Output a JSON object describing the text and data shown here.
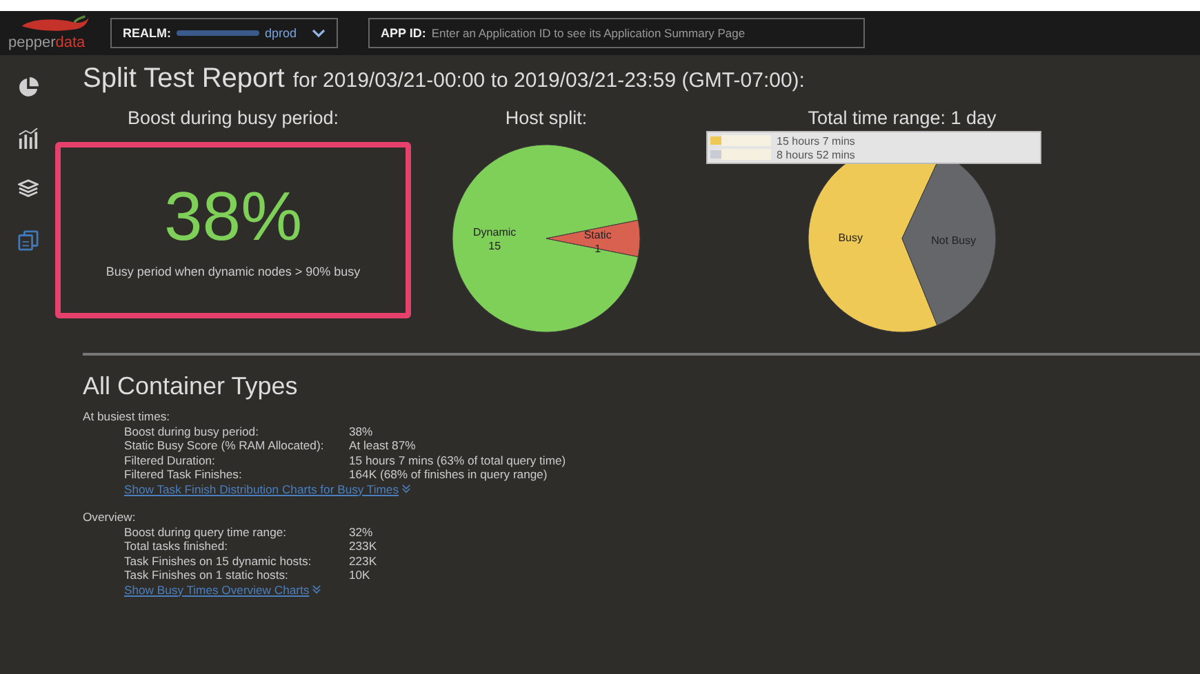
{
  "header": {
    "logo": {
      "first": "pepper",
      "second": "data"
    },
    "realm": {
      "label": "REALM:",
      "value": "dprod"
    },
    "app_id": {
      "label": "APP ID:",
      "placeholder": "Enter an Application ID to see its Application Summary Page"
    }
  },
  "sidebar": {
    "items": [
      {
        "kind": "pie",
        "selected": false
      },
      {
        "kind": "bars",
        "selected": false
      },
      {
        "kind": "layers",
        "selected": false
      },
      {
        "kind": "documents",
        "selected": true
      }
    ]
  },
  "report": {
    "title": "Split Test Report",
    "range": "for 2019/03/21-00:00 to 2019/03/21-23:59 (GMT-07:00):"
  },
  "boost": {
    "title": "Boost during busy period:",
    "value": "38%",
    "caption": "Busy period when dynamic nodes > 90% busy"
  },
  "host_split": {
    "chart_data": {
      "type": "pie",
      "title": "Host split:",
      "categories": [
        "Dynamic",
        "Static"
      ],
      "values": [
        15,
        1
      ],
      "colors": [
        "#7ed058",
        "#d9614f"
      ],
      "data_labels": true
    }
  },
  "time_range": {
    "chart_data": {
      "type": "pie",
      "title": "Total time range: 1 day",
      "categories": [
        "Busy",
        "Not Busy"
      ],
      "values": [
        63,
        37
      ],
      "colors": [
        "#efc955",
        "#64666a"
      ]
    },
    "legend": [
      {
        "text": "15 hours 7 mins",
        "color": "#efc955"
      },
      {
        "text": "8 hours 52 mins",
        "color": "#c9ccd4"
      }
    ]
  },
  "section": {
    "title": "All Container Types",
    "groups": [
      {
        "heading": "At busiest times:",
        "rows": [
          {
            "label": "Boost during busy period:",
            "value": "38%"
          },
          {
            "label": "Static Busy Score (% RAM Allocated):",
            "value": "At least 87%"
          },
          {
            "label": "Filtered Duration:",
            "value": "15 hours 7 mins (63% of total query time)"
          },
          {
            "label": "Filtered Task Finishes:",
            "value": "164K (68% of finishes in query range)"
          }
        ],
        "link": "Show Task Finish Distribution Charts for Busy Times"
      },
      {
        "heading": "Overview:",
        "rows": [
          {
            "label": "Boost during query time range:",
            "value": "32%"
          },
          {
            "label": "Total tasks finished:",
            "value": "233K"
          },
          {
            "label": "Task Finishes on 15 dynamic hosts:",
            "value": "223K"
          },
          {
            "label": "Task Finishes on 1 static hosts:",
            "value": "10K"
          }
        ],
        "link": "Show Busy Times Overview Charts"
      }
    ]
  }
}
